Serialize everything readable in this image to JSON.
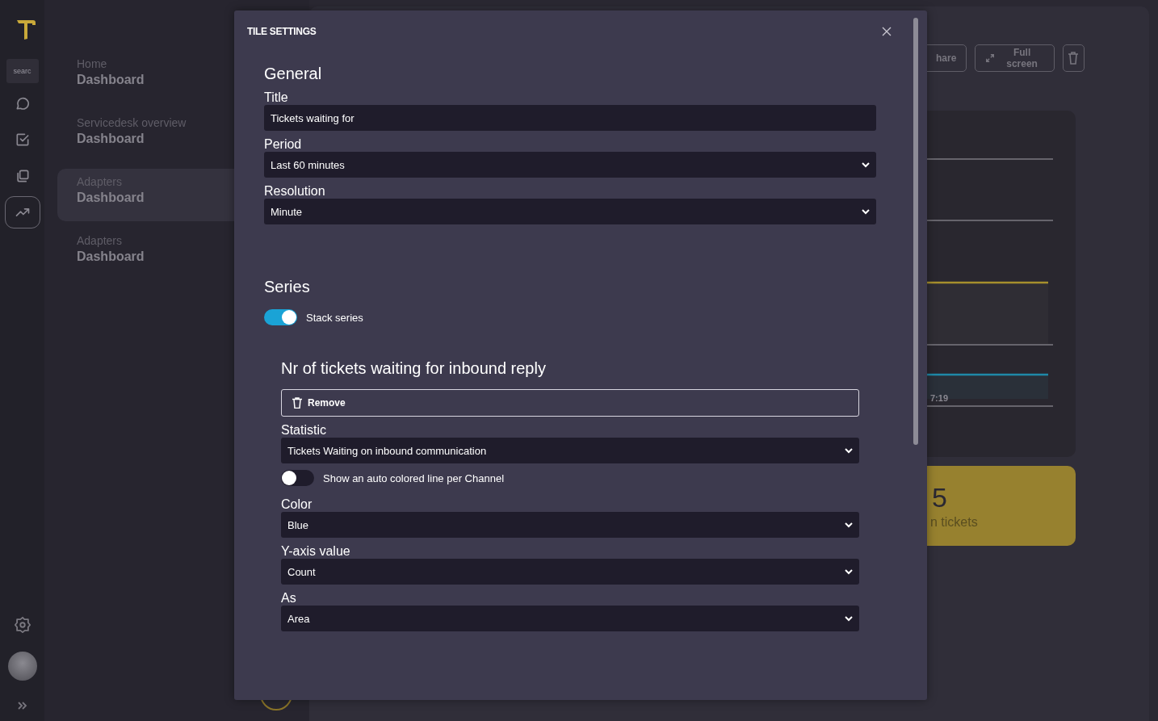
{
  "rail": {
    "search": {
      "placeholder": "searc"
    },
    "items": [
      {
        "kind": "chat",
        "selected": false
      },
      {
        "kind": "tasks",
        "selected": false
      },
      {
        "kind": "copy",
        "selected": false
      },
      {
        "kind": "trend",
        "selected": true
      }
    ]
  },
  "sidebar": {
    "items": [
      {
        "subtitle": "Home",
        "title": "Dashboard",
        "selected": false
      },
      {
        "subtitle": "Servicedesk overview",
        "title": "Dashboard",
        "selected": false
      },
      {
        "subtitle": "Adapters",
        "title": "Dashboard",
        "selected": true
      },
      {
        "subtitle": "Adapters",
        "title": "Dashboard",
        "selected": false
      }
    ]
  },
  "toolbar": {
    "buttons": [
      {
        "kind": "share",
        "label": "hare"
      },
      {
        "kind": "fullscreen",
        "label": "Full screen"
      },
      {
        "kind": "delete"
      }
    ]
  },
  "chart_tile": {
    "axis_label": "7:19"
  },
  "stat_tile": {
    "value": "5",
    "label": "n tickets"
  },
  "modal": {
    "title": "TILE SETTINGS",
    "general": {
      "heading": "General",
      "fields": [
        {
          "kind": "text",
          "label": "Title",
          "value": "Tickets waiting for"
        },
        {
          "kind": "select",
          "label": "Period",
          "value": "Last 60 minutes"
        },
        {
          "kind": "select",
          "label": "Resolution",
          "value": "Minute"
        }
      ]
    },
    "series": {
      "heading": "Series",
      "stack": {
        "label": "Stack series",
        "on": true
      },
      "items": [
        {
          "heading": "Nr of tickets waiting for inbound reply",
          "remove_label": "Remove",
          "fields": [
            {
              "kind": "select",
              "label": "Statistic",
              "value": "Tickets Waiting on inbound communication"
            },
            {
              "kind": "toggle",
              "label": "Show an auto colored line per Channel",
              "on": false
            },
            {
              "kind": "select",
              "label": "Color",
              "value": "Blue"
            },
            {
              "kind": "select",
              "label": "Y-axis value",
              "value": "Count"
            },
            {
              "kind": "select",
              "label": "As",
              "value": "Area"
            }
          ]
        }
      ]
    }
  }
}
